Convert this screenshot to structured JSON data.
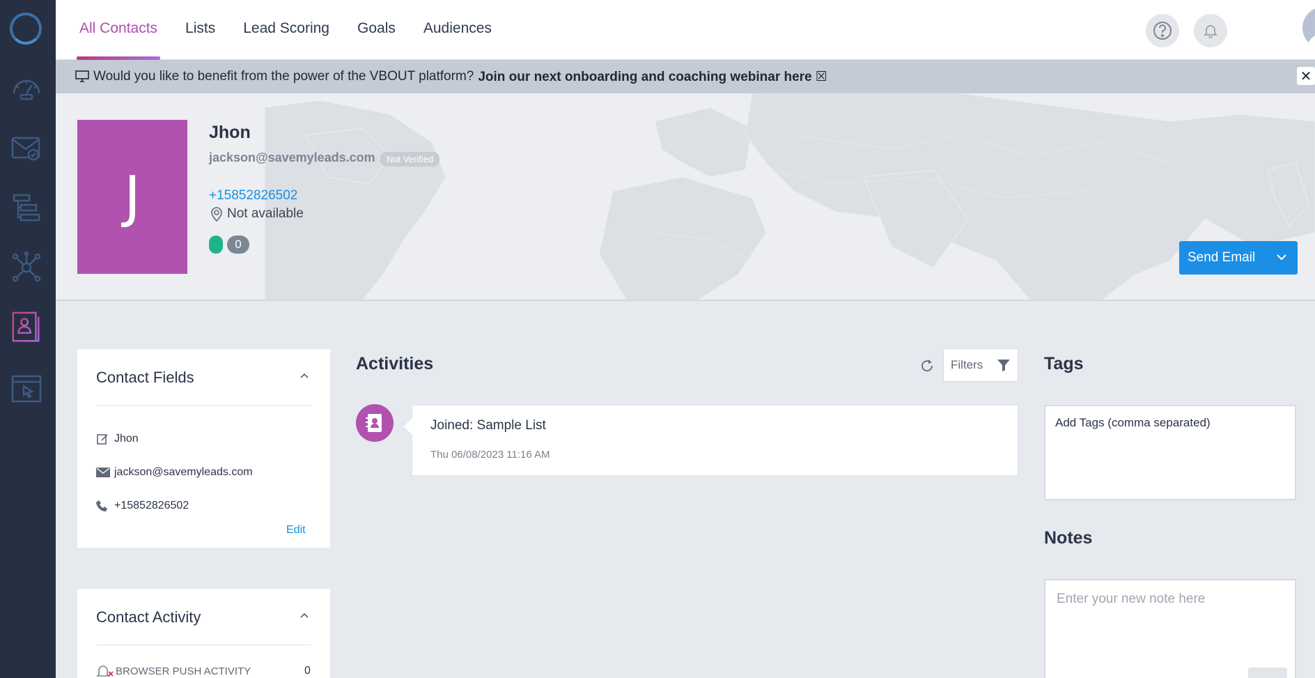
{
  "nav": {
    "tabs": [
      "All Contacts",
      "Lists",
      "Lead Scoring",
      "Goals",
      "Audiences"
    ],
    "active_index": 0
  },
  "banner": {
    "text": "Would you like to benefit from the power of the VBOUT platform?",
    "link_text": "Join our next onboarding and coaching webinar here ☒",
    "close": "✕"
  },
  "contact": {
    "initial": "J",
    "name": "Jhon",
    "email": "jackson@savemyleads.com",
    "verify_badge": "Not Verified",
    "phone": "+15852826502",
    "location": "Not available",
    "score_count": "0",
    "status_color": "#1fb38a"
  },
  "actions": {
    "send_email": "Send Email"
  },
  "contact_fields": {
    "title": "Contact Fields",
    "fields": [
      {
        "icon": "edit-icon",
        "value": "Jhon"
      },
      {
        "icon": "envelope-icon",
        "value": "jackson@savemyleads.com"
      },
      {
        "icon": "phone-icon",
        "value": "+15852826502"
      }
    ],
    "edit_label": "Edit"
  },
  "contact_activity": {
    "title": "Contact Activity",
    "rows": [
      {
        "icon": "bell-off-icon",
        "label": "BROWSER PUSH ACTIVITY",
        "count": "0"
      }
    ]
  },
  "activities": {
    "title": "Activities",
    "filters_label": "Filters",
    "items": [
      {
        "icon": "contact-book-icon",
        "text": "Joined: Sample List",
        "time": "Thu 06/08/2023 11:16 AM"
      }
    ]
  },
  "tags": {
    "title": "Tags",
    "value": "Add Tags (comma separated)"
  },
  "notes": {
    "title": "Notes",
    "placeholder": "Enter your new note here"
  },
  "colors": {
    "accent": "#b052ae",
    "primary": "#1b8fe5",
    "sidebar": "#263042"
  }
}
